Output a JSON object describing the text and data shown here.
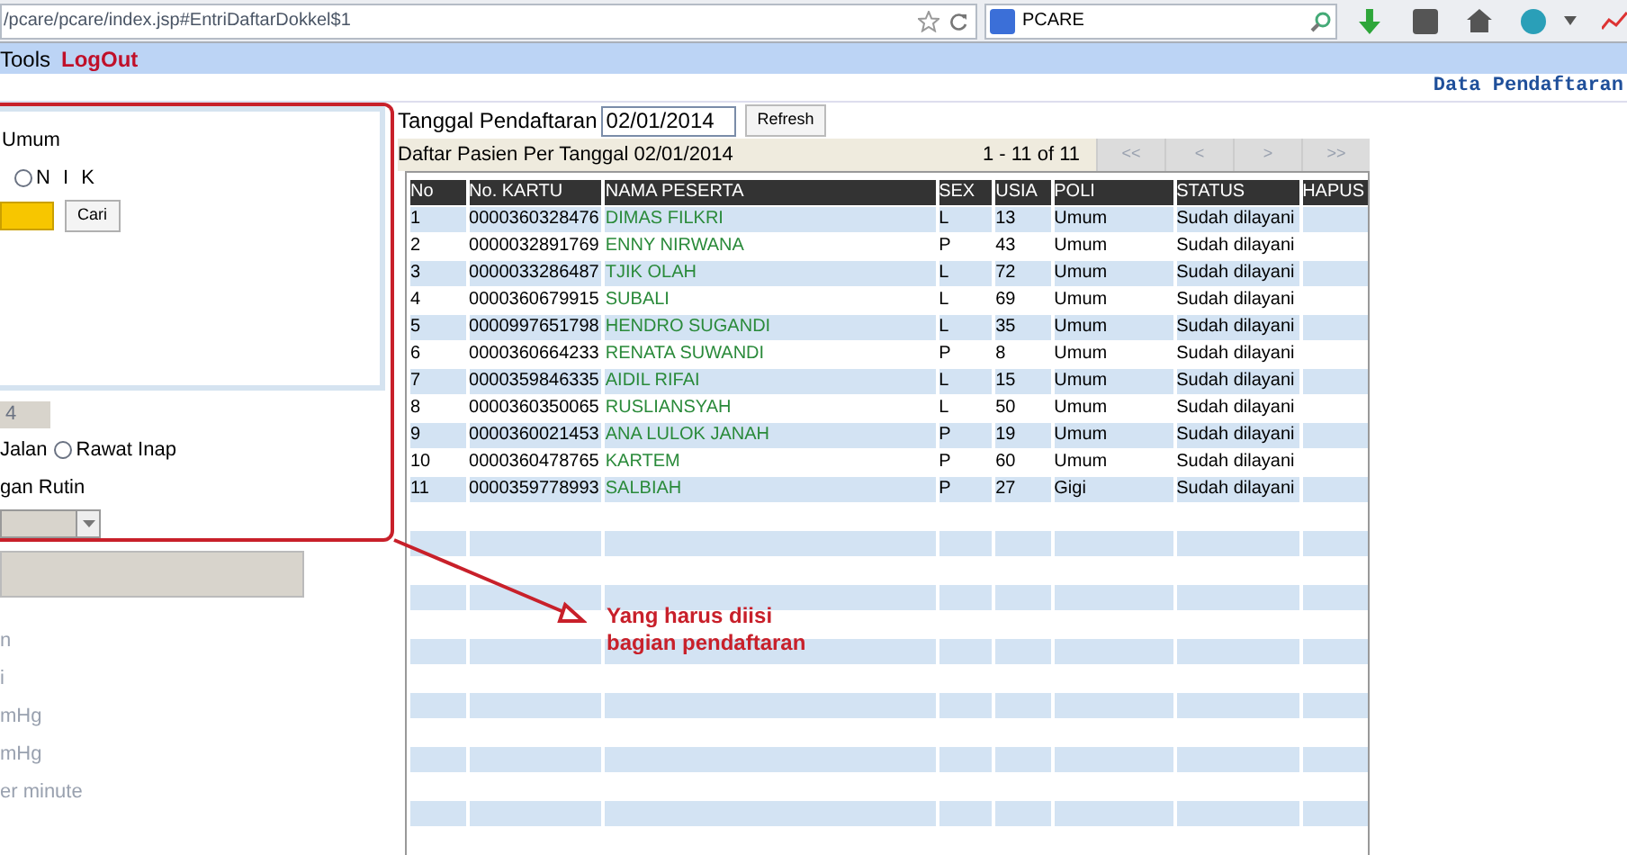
{
  "browser": {
    "url": "/pcare/pcare/index.jsp#EntriDaftarDokkel$1",
    "search": "PCARE"
  },
  "menu": [
    {
      "label": "Tools",
      "kind": "plain"
    },
    {
      "label": "LogOut",
      "kind": "logout"
    }
  ],
  "header_title": "Data Pendaftaran",
  "left_panel": {
    "jenis_label": "Umum",
    "nik_radio": {
      "label": "N I K",
      "selected": false
    },
    "search_button": "Cari",
    "field_value": "4",
    "radios": [
      {
        "label": "Jalan"
      },
      {
        "label": "Rawat Inap",
        "selected": false
      }
    ],
    "rutin_label": "gan Rutin",
    "faded_labels": [
      "n",
      "i",
      "mHg",
      "mHg",
      "er minute"
    ]
  },
  "filter": {
    "label": "Tanggal Pendaftaran",
    "date": "02/01/2014",
    "refresh_button": "Refresh"
  },
  "list_bar": {
    "title": "Daftar Pasien Per Tanggal 02/01/2014",
    "count": "1 - 11 of 11",
    "pager": [
      {
        "label": "<<",
        "disabled": true
      },
      {
        "label": "<",
        "disabled": true
      },
      {
        "label": ">",
        "disabled": true
      },
      {
        "label": ">>",
        "disabled": true
      }
    ]
  },
  "table": {
    "columns": [
      "No",
      "No. KARTU",
      "NAMA PESERTA",
      "SEX",
      "USIA",
      "POLI",
      "STATUS",
      "HAPUS"
    ],
    "rows": [
      [
        "1",
        "0000360328476",
        "DIMAS FILKRI",
        "L",
        "13",
        "Umum",
        "Sudah dilayani"
      ],
      [
        "2",
        "0000032891769",
        "ENNY NIRWANA",
        "P",
        "43",
        "Umum",
        "Sudah dilayani"
      ],
      [
        "3",
        "0000033286487",
        "TJIK OLAH",
        "L",
        "72",
        "Umum",
        "Sudah dilayani"
      ],
      [
        "4",
        "0000360679915",
        "SUBALI",
        "L",
        "69",
        "Umum",
        "Sudah dilayani"
      ],
      [
        "5",
        "0000997651798",
        "HENDRO SUGANDI",
        "L",
        "35",
        "Umum",
        "Sudah dilayani"
      ],
      [
        "6",
        "0000360664233",
        "RENATA SUWANDI",
        "P",
        "8",
        "Umum",
        "Sudah dilayani"
      ],
      [
        "7",
        "0000359846335",
        "AIDIL RIFAI",
        "L",
        "15",
        "Umum",
        "Sudah dilayani"
      ],
      [
        "8",
        "0000360350065",
        "RUSLIANSYAH",
        "L",
        "50",
        "Umum",
        "Sudah dilayani"
      ],
      [
        "9",
        "0000360021453",
        "ANA LULOK JANAH",
        "P",
        "19",
        "Umum",
        "Sudah dilayani"
      ],
      [
        "10",
        "0000360478765",
        "KARTEM",
        "P",
        "60",
        "Umum",
        "Sudah dilayani"
      ],
      [
        "11",
        "0000359778993",
        "SALBIAH",
        "P",
        "27",
        "Gigi",
        "Sudah dilayani"
      ]
    ]
  },
  "annotation": [
    "Yang harus diisi",
    "bagian pendaftaran"
  ]
}
